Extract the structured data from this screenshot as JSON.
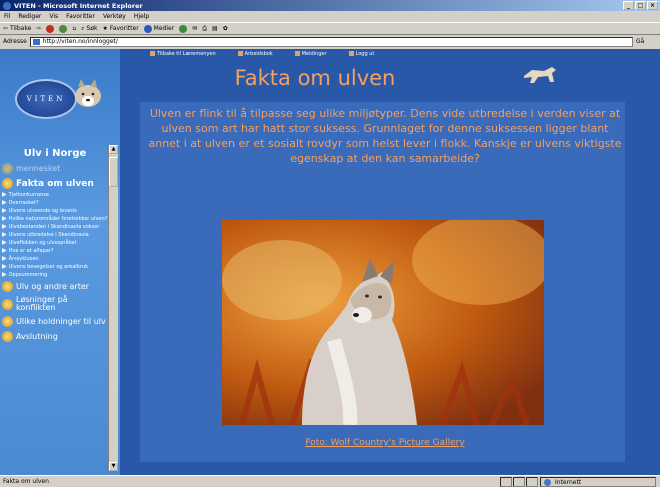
{
  "window": {
    "title": "VITEN - Microsoft Internet Explorer"
  },
  "menu": [
    "Fil",
    "Rediger",
    "Vis",
    "Favoritter",
    "Verktøy",
    "Hjelp"
  ],
  "toolbar": {
    "back": "Tilbake",
    "search": "Søk",
    "favorites": "Favoritter",
    "media": "Medier"
  },
  "address": {
    "label": "Adresse",
    "url": "http://viten.no/innlogget/",
    "go": "Gå"
  },
  "topnav": [
    "Tilbake til Læremenyen",
    "Arbeidsbok",
    "Meldinger",
    "Logg ut"
  ],
  "sidebar": {
    "logo_text": "VITEN",
    "section_title": "Ulv i Norge",
    "items": [
      {
        "label": "mennesket",
        "kind": "big-faded"
      },
      {
        "label": "Fakta om ulven",
        "kind": "big-bold"
      },
      {
        "label": "Tjetkonkurranse",
        "kind": "small"
      },
      {
        "label": "Overrasket?",
        "kind": "small"
      },
      {
        "label": "Ulvens utseende og levesis",
        "kind": "small"
      },
      {
        "label": "Hvilke naturområder foretrekker ulven?",
        "kind": "small"
      },
      {
        "label": "Ulvebestanden i Skandinavia vokser",
        "kind": "small"
      },
      {
        "label": "Ulvens utbredelse i Skandinavia",
        "kind": "small"
      },
      {
        "label": "Ulveflokken og ulvespråket",
        "kind": "small"
      },
      {
        "label": "Hva er et alfapar?",
        "kind": "small"
      },
      {
        "label": "Årssyklusen",
        "kind": "small"
      },
      {
        "label": "Ulvens bevegelser og arealbruk",
        "kind": "small"
      },
      {
        "label": "Oppsummering",
        "kind": "small"
      },
      {
        "label": "Ulv og andre arter",
        "kind": "big"
      },
      {
        "label": "Løsninger på konflikten",
        "kind": "big"
      },
      {
        "label": "Ulike holdninger til ulv",
        "kind": "big"
      },
      {
        "label": "Avslutning",
        "kind": "big"
      }
    ]
  },
  "main": {
    "title": "Fakta om ulven",
    "intro": "Ulven er flink til å tilpasse seg ulike miljøtyper. Dens vide utbredelse i verden viser at ulven som art har hatt stor suksess. Grunnlaget for denne suksessen ligger blant annet i at ulven er et sosialt rovdyr som helst lever i flokk.  Kanskje er ulvens viktigste egenskap at den kan samarbeide?",
    "photo_credit": "Foto: Wolf Country's Picture Gallery"
  },
  "status": {
    "text": "Fakta om ulven",
    "zone": "Internett"
  }
}
